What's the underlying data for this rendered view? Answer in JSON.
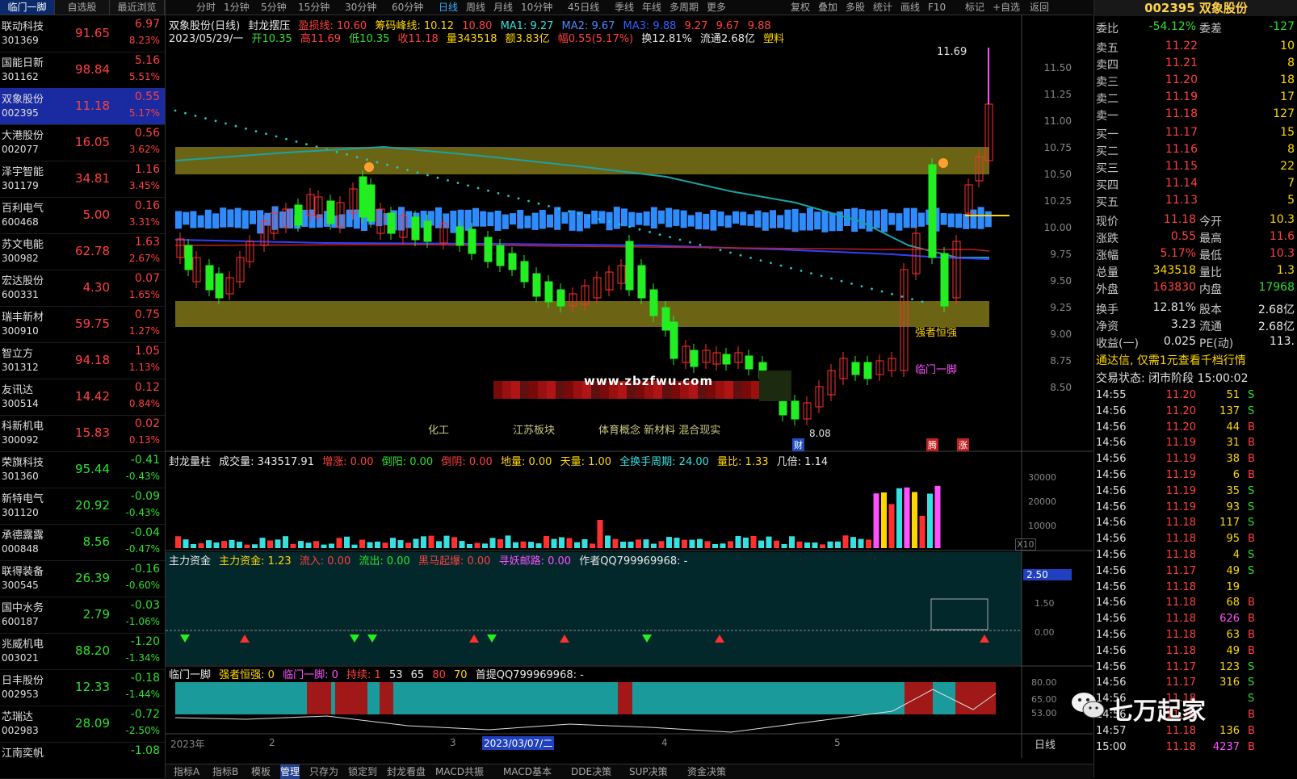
{
  "left_header": [
    "临门一脚",
    "自选股",
    "最近浏览"
  ],
  "watchlist": [
    {
      "name": "联动科技",
      "code": "301369",
      "price": "91.65",
      "change": "6.97",
      "pct": "8.23%"
    },
    {
      "name": "国能日新",
      "code": "301162",
      "price": "98.84",
      "change": "5.16",
      "pct": "5.51%"
    },
    {
      "name": "双象股份",
      "code": "002395",
      "price": "11.18",
      "change": "0.55",
      "pct": "5.17%"
    },
    {
      "name": "大港股份",
      "code": "002077",
      "price": "16.05",
      "change": "0.56",
      "pct": "3.62%"
    },
    {
      "name": "泽宇智能",
      "code": "301179",
      "price": "34.81",
      "change": "1.16",
      "pct": "3.45%"
    },
    {
      "name": "百利电气",
      "code": "600468",
      "price": "5.00",
      "change": "0.16",
      "pct": "3.31%"
    },
    {
      "name": "苏文电能",
      "code": "300982",
      "price": "62.78",
      "change": "1.63",
      "pct": "2.67%"
    },
    {
      "name": "宏达股份",
      "code": "600331",
      "price": "4.30",
      "change": "0.07",
      "pct": "1.65%"
    },
    {
      "name": "瑞丰新材",
      "code": "300910",
      "price": "59.75",
      "change": "0.75",
      "pct": "1.27%"
    },
    {
      "name": "智立方",
      "code": "301312",
      "price": "94.18",
      "change": "1.05",
      "pct": "1.13%"
    },
    {
      "name": "友讯达",
      "code": "300514",
      "price": "14.42",
      "change": "0.12",
      "pct": "0.84%"
    },
    {
      "name": "科新机电",
      "code": "300092",
      "price": "15.83",
      "change": "0.02",
      "pct": "0.13%"
    },
    {
      "name": "荣旗科技",
      "code": "301360",
      "price": "95.44",
      "change": "-0.41",
      "pct": "-0.43%"
    },
    {
      "name": "新特电气",
      "code": "301120",
      "price": "20.92",
      "change": "-0.09",
      "pct": "-0.43%"
    },
    {
      "name": "承德露露",
      "code": "000848",
      "price": "8.56",
      "change": "-0.04",
      "pct": "-0.47%"
    },
    {
      "name": "联得装备",
      "code": "300545",
      "price": "26.39",
      "change": "-0.16",
      "pct": "-0.60%"
    },
    {
      "name": "国中水务",
      "code": "600187",
      "price": "2.79",
      "change": "-0.03",
      "pct": "-1.06%"
    },
    {
      "name": "兆威机电",
      "code": "003021",
      "price": "88.20",
      "change": "-1.20",
      "pct": "-1.34%"
    },
    {
      "name": "日丰股份",
      "code": "002953",
      "price": "12.33",
      "change": "-0.18",
      "pct": "-1.44%"
    },
    {
      "name": "芯瑞达",
      "code": "002983",
      "price": "28.09",
      "change": "-0.72",
      "pct": "-2.50%"
    },
    {
      "name": "江南奕帆",
      "code": "",
      "price": "",
      "change": "-1.08",
      "pct": ""
    }
  ],
  "toolbar": {
    "periods": [
      "分时",
      "1分钟",
      "5分钟",
      "15分钟",
      "30分钟",
      "60分钟",
      "日线",
      "周线",
      "月线",
      "10分钟",
      "45日线",
      "季线",
      "年线",
      "多周期",
      "更多"
    ],
    "tools": [
      "复权",
      "叠加",
      "多股",
      "统计",
      "画线",
      "F10",
      "标记",
      "+自选",
      "返回"
    ]
  },
  "chart": {
    "title_line": {
      "name": "双象股份(日线)",
      "indicator": "封龙摆压",
      "zhiying": "盈损线: 10.60",
      "chouma": "筹码峰线: 10.12",
      "v3": "10.80",
      "ma1": "MA1: 9.27",
      "ma2": "MA2: 9.67",
      "ma3": "MA3: 9.88",
      "v4": "9.27",
      "v5": "9.67",
      "v6": "9.88"
    },
    "ohlc_line": {
      "date": "2023/05/29/一",
      "open": "开10.35",
      "high": "高11.69",
      "low": "低10.35",
      "close": "收11.18",
      "vol": "量343518",
      "amt": "额3.83亿",
      "chg": "幅0.55(5.17%)",
      "turn": "换12.81%",
      "float": "流通2.68亿",
      "sector": "塑料"
    },
    "price_axis": [
      "11.50",
      "11.25",
      "11.00",
      "10.75",
      "10.50",
      "10.25",
      "10.00",
      "9.75",
      "9.50",
      "9.25",
      "9.00",
      "8.75",
      "8.50"
    ],
    "max_label": "11.69",
    "min_label": "8.08",
    "sectors": [
      "化工",
      "江苏板块",
      "体育概念 新材料 混合现实"
    ],
    "watermark": "www.zbzfwu.com",
    "labels": {
      "strong": "强者恒强",
      "linmen": "临门一脚",
      "cai": "财",
      "teng": "腾",
      "zhang": "涨"
    }
  },
  "volume_panel": {
    "line": [
      "封龙量柱",
      "成交量: 343517.91",
      "增涨: 0.00",
      "倒阳: 0.00",
      "倒阴: 0.00",
      "地量: 0.00",
      "天量: 1.00",
      "全换手周期: 24.00",
      "量比: 1.33",
      "几倍: 1.14"
    ],
    "axis": [
      "30000",
      "20000",
      "10000",
      "X10"
    ]
  },
  "fund_panel": {
    "line": [
      "主力资金",
      "主力资金: 1.23",
      "流入: 0.00",
      "流出: 0.00",
      "黑马起爆: 0.00",
      "寻妖邮路: 0.00",
      "作者QQ799969968: -"
    ],
    "axis": [
      "2.50",
      "1.50",
      "0.00"
    ]
  },
  "linmen_panel": {
    "line": [
      "临门一脚",
      "强者恒强: 0",
      "临门一脚: 0",
      "持续: 1",
      "53",
      "65",
      "80",
      "70",
      "首提QQ799969968: -"
    ],
    "axis": [
      "80.00",
      "65.00",
      "53.00"
    ]
  },
  "date_axis": [
    "2023年",
    "2",
    "3",
    "2023/03/07/二",
    "4",
    "5"
  ],
  "period_label": "日线",
  "bottom_tabs": [
    "指标A",
    "指标B",
    "模板",
    "管理",
    "只存为",
    "锁定到",
    "封龙看盘",
    "MACD共振",
    "MACD基本",
    "DDE决策",
    "SUP决策",
    "资金决策"
  ],
  "right": {
    "title": "002395 双象股份",
    "weibi": {
      "k": "委比",
      "v": "-54.12%",
      "k2": "委差",
      "v2": "-127"
    },
    "asks": [
      {
        "label": "卖五",
        "price": "11.22",
        "vol": "10"
      },
      {
        "label": "卖四",
        "price": "11.21",
        "vol": "8"
      },
      {
        "label": "卖三",
        "price": "11.20",
        "vol": "18"
      },
      {
        "label": "卖二",
        "price": "11.19",
        "vol": "17"
      },
      {
        "label": "卖一",
        "price": "11.18",
        "vol": "127"
      }
    ],
    "bids": [
      {
        "label": "买一",
        "price": "11.17",
        "vol": "15"
      },
      {
        "label": "买二",
        "price": "11.16",
        "vol": "8"
      },
      {
        "label": "买三",
        "price": "11.15",
        "vol": "22"
      },
      {
        "label": "买四",
        "price": "11.14",
        "vol": "7"
      },
      {
        "label": "买五",
        "price": "11.13",
        "vol": "5"
      }
    ],
    "stats": [
      {
        "k1": "现价",
        "v1": "11.18",
        "k2": "今开",
        "v2": "10.3"
      },
      {
        "k1": "涨跌",
        "v1": "0.55",
        "k2": "最高",
        "v2": "11.6"
      },
      {
        "k1": "涨幅",
        "v1": "5.17%",
        "k2": "最低",
        "v2": "10.3"
      },
      {
        "k1": "总量",
        "v1": "343518",
        "k2": "量比",
        "v2": "1.3"
      },
      {
        "k1": "外盘",
        "v1": "163830",
        "k2": "内盘",
        "v2": "17968"
      },
      {
        "k1": "换手",
        "v1": "12.81%",
        "k2": "股本",
        "v2": "2.68亿"
      },
      {
        "k1": "净资",
        "v1": "3.23",
        "k2": "流通",
        "v2": "2.68亿"
      },
      {
        "k1": "收益(一)",
        "v1": "0.025",
        "k2": "PE(动)",
        "v2": "113."
      }
    ],
    "promo": "通达信, 仅需1元查看千档行情",
    "trade_status": "交易状态: 闭市阶段 15:00:02",
    "ticks": [
      {
        "t": "14:55",
        "p": "11.20",
        "v": "51",
        "s": "S"
      },
      {
        "t": "14:56",
        "p": "11.20",
        "v": "137",
        "s": "S"
      },
      {
        "t": "14:56",
        "p": "11.20",
        "v": "44",
        "s": "B"
      },
      {
        "t": "14:56",
        "p": "11.19",
        "v": "31",
        "s": "B"
      },
      {
        "t": "14:56",
        "p": "11.19",
        "v": "38",
        "s": "B"
      },
      {
        "t": "14:56",
        "p": "11.19",
        "v": "6",
        "s": "B"
      },
      {
        "t": "14:56",
        "p": "11.19",
        "v": "35",
        "s": "S"
      },
      {
        "t": "14:56",
        "p": "11.19",
        "v": "93",
        "s": "S"
      },
      {
        "t": "14:56",
        "p": "11.18",
        "v": "117",
        "s": "S"
      },
      {
        "t": "14:56",
        "p": "11.18",
        "v": "95",
        "s": "B"
      },
      {
        "t": "14:56",
        "p": "11.18",
        "v": "4",
        "s": "S"
      },
      {
        "t": "14:56",
        "p": "11.17",
        "v": "49",
        "s": "S"
      },
      {
        "t": "14:56",
        "p": "11.18",
        "v": "19",
        "s": ""
      },
      {
        "t": "14:56",
        "p": "11.18",
        "v": "68",
        "s": "B"
      },
      {
        "t": "14:56",
        "p": "11.18",
        "v": "626",
        "s": "B"
      },
      {
        "t": "14:56",
        "p": "11.18",
        "v": "63",
        "s": "B"
      },
      {
        "t": "14:56",
        "p": "11.18",
        "v": "49",
        "s": "B"
      },
      {
        "t": "14:56",
        "p": "11.17",
        "v": "123",
        "s": "S"
      },
      {
        "t": "14:56",
        "p": "11.17",
        "v": "316",
        "s": "S"
      },
      {
        "t": "14:56",
        "p": "11.18",
        "v": "",
        "s": "S"
      },
      {
        "t": "14:56",
        "p": "11.18",
        "v": "",
        "s": "B"
      },
      {
        "t": "14:57",
        "p": "11.18",
        "v": "136",
        "s": "B"
      },
      {
        "t": "15:00",
        "p": "11.18",
        "v": "4237",
        "s": "B"
      }
    ],
    "wechat": "七万起家"
  },
  "colors": {
    "up": "#ff4040",
    "down": "#2ee02e",
    "band": "#6b6414",
    "blue": "#2f8cff",
    "teal": "#1aa3a3"
  }
}
